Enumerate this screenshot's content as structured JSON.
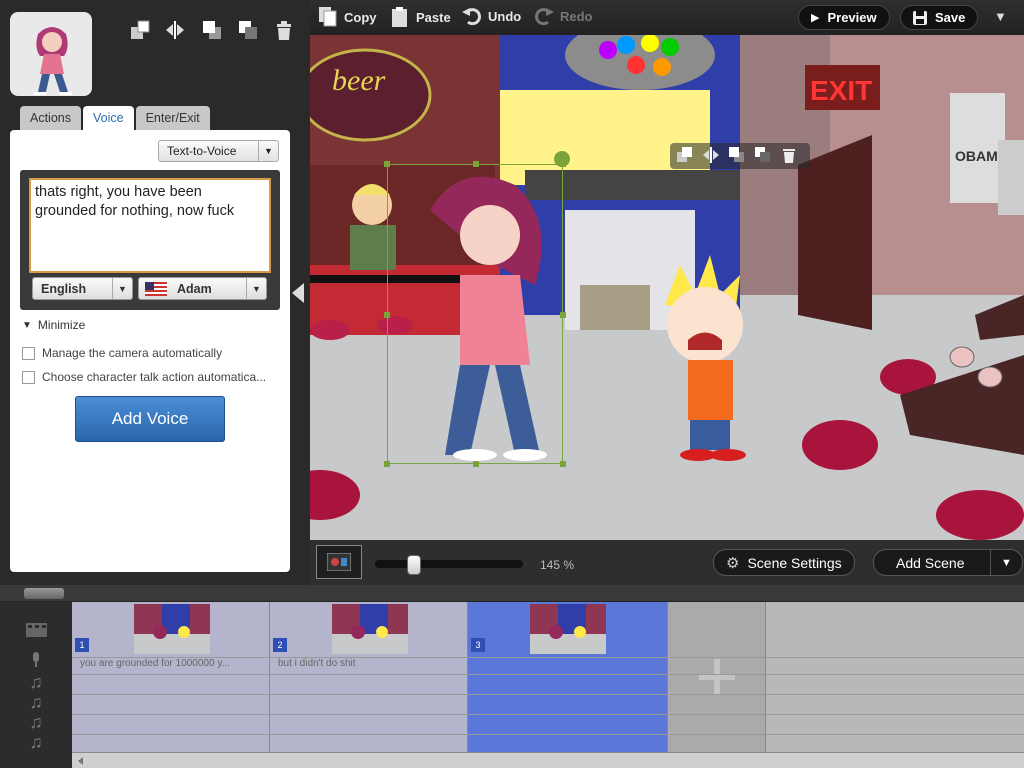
{
  "left_panel": {
    "tabs": [
      "Actions",
      "Voice",
      "Enter/Exit"
    ],
    "active_tab": "Voice",
    "voice_type": "Text-to-Voice",
    "tts_text": "thats right, you have been grounded for nothing, now fuck",
    "language": "English",
    "voice_name": "Adam",
    "minimize_label": "Minimize",
    "option_camera": "Manage the camera automatically",
    "option_talk": "Choose character talk action automatica...",
    "add_voice_label": "Add Voice"
  },
  "toolbar": {
    "copy": "Copy",
    "paste": "Paste",
    "undo": "Undo",
    "redo": "Redo",
    "preview": "Preview",
    "save": "Save"
  },
  "stage": {
    "sign_beer": "beer",
    "sign_exit": "EXIT",
    "poster_text": "OBAMA",
    "zoom_label": "145 %"
  },
  "stage_bar": {
    "scene_settings": "Scene Settings",
    "add_scene": "Add Scene"
  },
  "timeline": {
    "scenes": [
      {
        "number": "1",
        "dialog": "you are grounded for 1000000 y..."
      },
      {
        "number": "2",
        "dialog": "but i didn't do shit"
      },
      {
        "number": "3",
        "dialog": ""
      }
    ],
    "selected_scene": 3
  },
  "colors": {
    "accent_blue": "#2a6db3",
    "selected_scene": "#5b78d8",
    "selection_green": "#7aa43a"
  }
}
